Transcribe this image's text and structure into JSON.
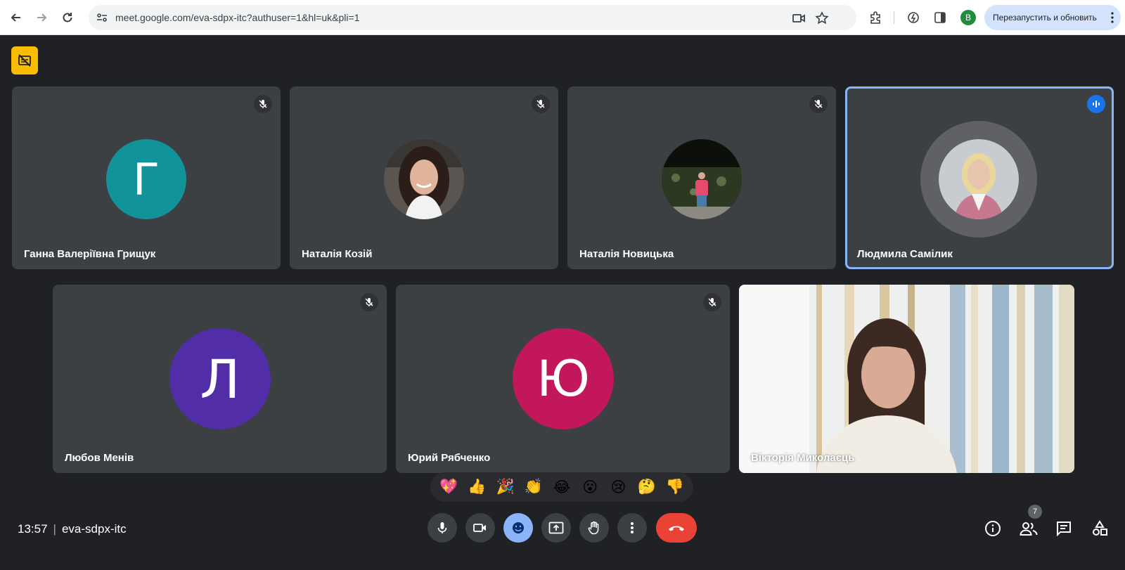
{
  "browser": {
    "url": "meet.google.com/eva-sdpx-itc?authuser=1&hl=uk&pli=1",
    "profile_initial": "B",
    "relaunch_label": "Перезапустить и обновить"
  },
  "participants": [
    {
      "name": "Ганна Валеріївна Грищук",
      "avatar": "letter",
      "letter": "Г",
      "color": "#12939a",
      "muted": true
    },
    {
      "name": "Наталія Козій",
      "avatar": "photo",
      "muted": true
    },
    {
      "name": "Наталія Новицька",
      "avatar": "photo",
      "muted": true
    },
    {
      "name": "Людмила Самілик",
      "avatar": "photo",
      "muted": false,
      "speaking": true
    },
    {
      "name": "Любов Менів",
      "avatar": "letter",
      "letter": "Л",
      "color": "#512da8",
      "muted": true
    },
    {
      "name": "Юрий Рябченко",
      "avatar": "letter",
      "letter": "Ю",
      "color": "#c2185b",
      "muted": true
    },
    {
      "name": "Вікторія Миколаєць",
      "avatar": "video",
      "muted": false
    }
  ],
  "reactions": [
    "💖",
    "👍",
    "🎉",
    "👏",
    "😂",
    "😮",
    "😢",
    "🤔",
    "👎"
  ],
  "meeting": {
    "time": "13:57",
    "code": "eva-sdpx-itc",
    "participant_count": "7"
  },
  "colors": {
    "background": "#202124",
    "tile": "#3c4043",
    "accent": "#8ab4f8",
    "end_call": "#ea4335",
    "warning": "#fbbc04"
  }
}
